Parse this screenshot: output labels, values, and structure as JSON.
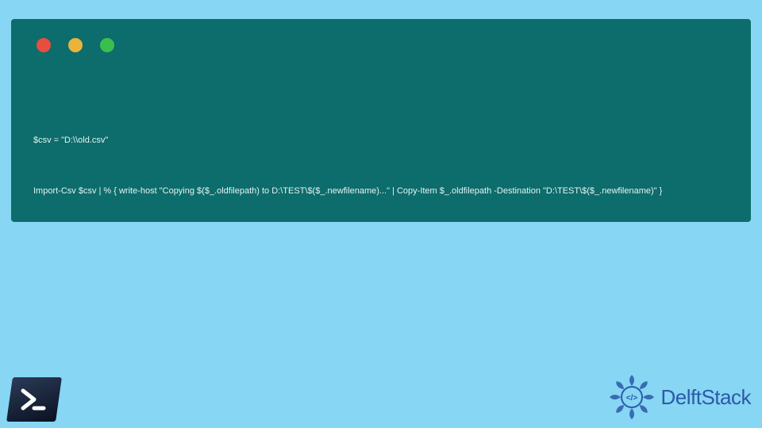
{
  "code": {
    "line1": "$csv = \"D:\\\\old.csv\"",
    "line2": "Import-Csv $csv | % { write-host \"Copying $($_.oldfilepath) to D:\\TEST\\$($_.newfilename)...\" | Copy-Item $_.oldfilepath -Destination \"D:\\TEST\\$($_.newfilename)\" }"
  },
  "brand": {
    "name": "DelftStack"
  }
}
